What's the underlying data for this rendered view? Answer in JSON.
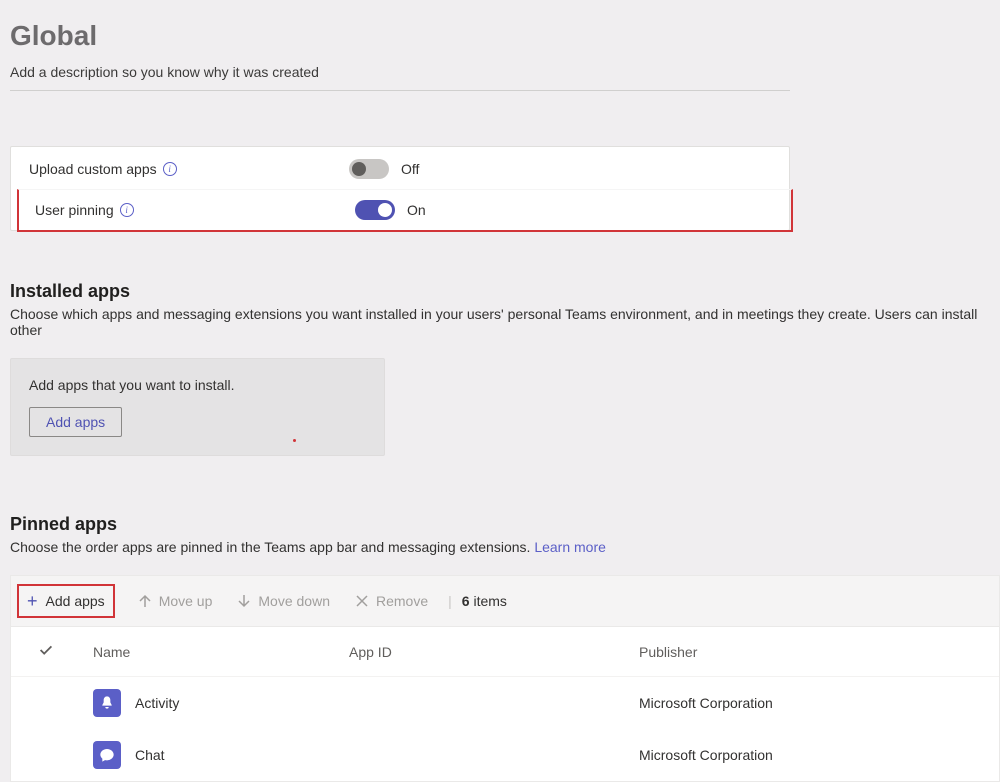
{
  "page_title": "Global",
  "description": "Add a description so you know why it was created",
  "settings": {
    "upload_custom_apps": {
      "label": "Upload custom apps",
      "state_text": "Off",
      "on": false
    },
    "user_pinning": {
      "label": "User pinning",
      "state_text": "On",
      "on": true
    }
  },
  "installed_apps": {
    "heading": "Installed apps",
    "desc": "Choose which apps and messaging extensions you want installed in your users' personal Teams environment, and in meetings they create. Users can install other",
    "panel_text": "Add apps that you want to install.",
    "add_button": "Add apps"
  },
  "pinned_apps": {
    "heading": "Pinned apps",
    "desc_prefix": "Choose the order apps are pinned in the Teams app bar and messaging extensions. ",
    "learn_more": "Learn more",
    "toolbar": {
      "add": "Add apps",
      "move_up": "Move up",
      "move_down": "Move down",
      "remove": "Remove",
      "count_num": "6",
      "count_label": " items"
    },
    "columns": {
      "name": "Name",
      "app_id": "App ID",
      "publisher": "Publisher"
    },
    "rows": [
      {
        "name": "Activity",
        "app_id": "",
        "publisher": "Microsoft Corporation",
        "icon": "bell"
      },
      {
        "name": "Chat",
        "app_id": "",
        "publisher": "Microsoft Corporation",
        "icon": "chat"
      }
    ]
  }
}
